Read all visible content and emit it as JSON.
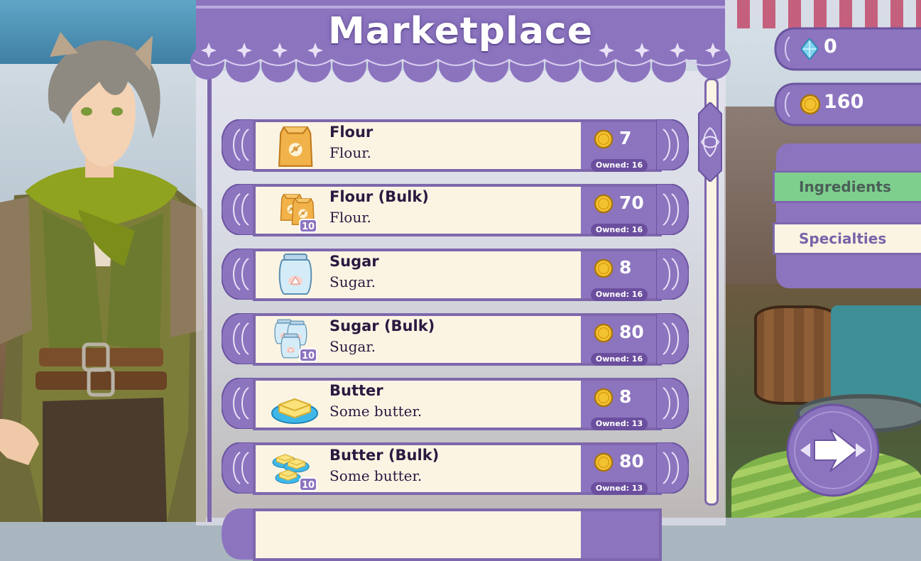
{
  "title": "Marketplace",
  "currency": {
    "gems": "0",
    "coins": "160"
  },
  "tabs": [
    {
      "label": "Ingredients",
      "active": true
    },
    {
      "label": "Specialties",
      "active": false
    }
  ],
  "items": [
    {
      "name": "Flour",
      "desc": "Flour.",
      "price": "7",
      "owned": "Owned: 16",
      "icon": "flour-bag-icon",
      "bulk": false
    },
    {
      "name": "Flour (Bulk)",
      "desc": "Flour.",
      "price": "70",
      "owned": "Owned: 16",
      "icon": "flour-bulk-icon",
      "bulk": true,
      "bulk_badge": "10"
    },
    {
      "name": "Sugar",
      "desc": "Sugar.",
      "price": "8",
      "owned": "Owned: 16",
      "icon": "sugar-jar-icon",
      "bulk": false
    },
    {
      "name": "Sugar (Bulk)",
      "desc": "Sugar.",
      "price": "80",
      "owned": "Owned: 16",
      "icon": "sugar-bulk-icon",
      "bulk": true,
      "bulk_badge": "10"
    },
    {
      "name": "Butter",
      "desc": "Some butter.",
      "price": "8",
      "owned": "Owned: 13",
      "icon": "butter-icon",
      "bulk": false
    },
    {
      "name": "Butter (Bulk)",
      "desc": "Some butter.",
      "price": "80",
      "owned": "Owned: 13",
      "icon": "butter-bulk-icon",
      "bulk": true,
      "bulk_badge": "10"
    }
  ],
  "colors": {
    "panel_purple": "#8c74bf",
    "frame_purple": "#7e67ad",
    "card_cream": "#fbf4e3",
    "active_tab_green": "#7ecf8e",
    "coin_gold": "#f2c230",
    "gem_blue": "#7fd3f0"
  }
}
